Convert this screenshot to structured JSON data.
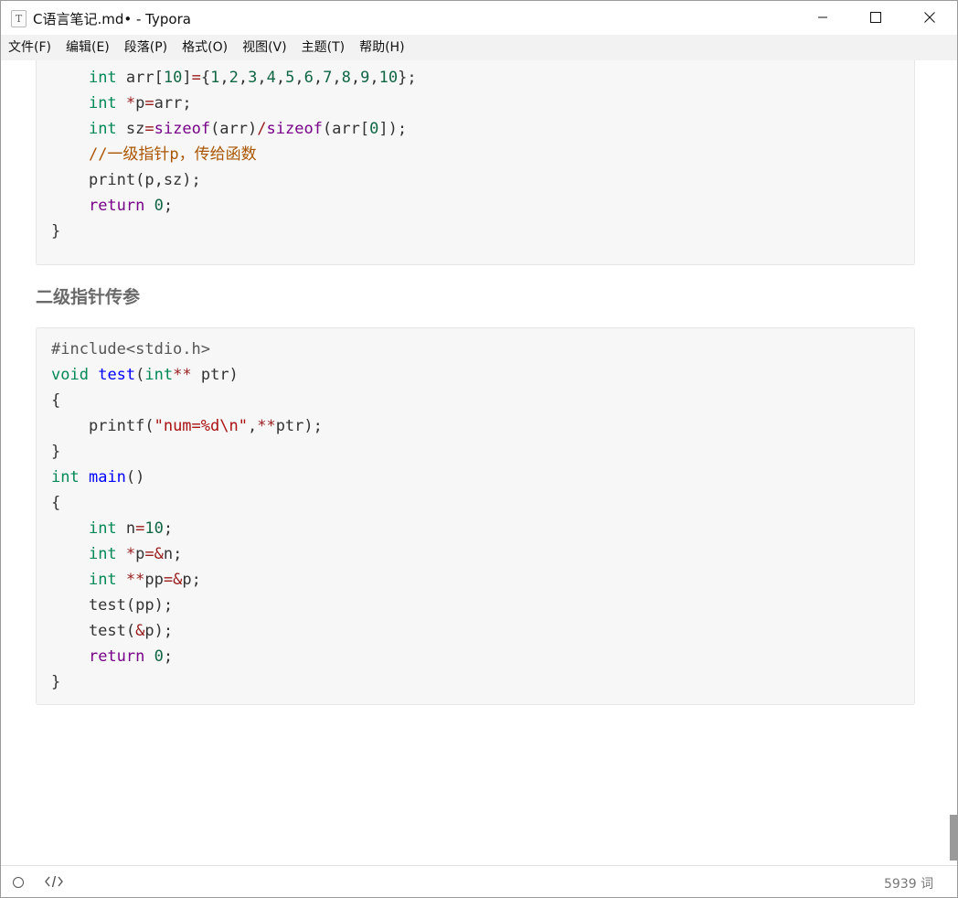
{
  "window": {
    "title": "C语言笔记.md• - Typora",
    "app_icon_letter": "T",
    "controls": {
      "minimize": "minimize-icon",
      "maximize": "maximize-icon",
      "close": "close-icon"
    }
  },
  "menu": [
    "文件(F)",
    "编辑(E)",
    "段落(P)",
    "格式(O)",
    "视图(V)",
    "主题(T)",
    "帮助(H)"
  ],
  "document": {
    "heading": "二级指针传参"
  },
  "status_bar": {
    "word_count": "5939 词",
    "icons": [
      "outline-toggle-icon",
      "source-code-icon"
    ]
  },
  "colors": {
    "keyword": "#008855",
    "keyword_control": "#770088",
    "function": "#0000ff",
    "operator": "#981a1a",
    "number": "#116644",
    "string": "#aa1111",
    "comment": "#aa5500"
  }
}
